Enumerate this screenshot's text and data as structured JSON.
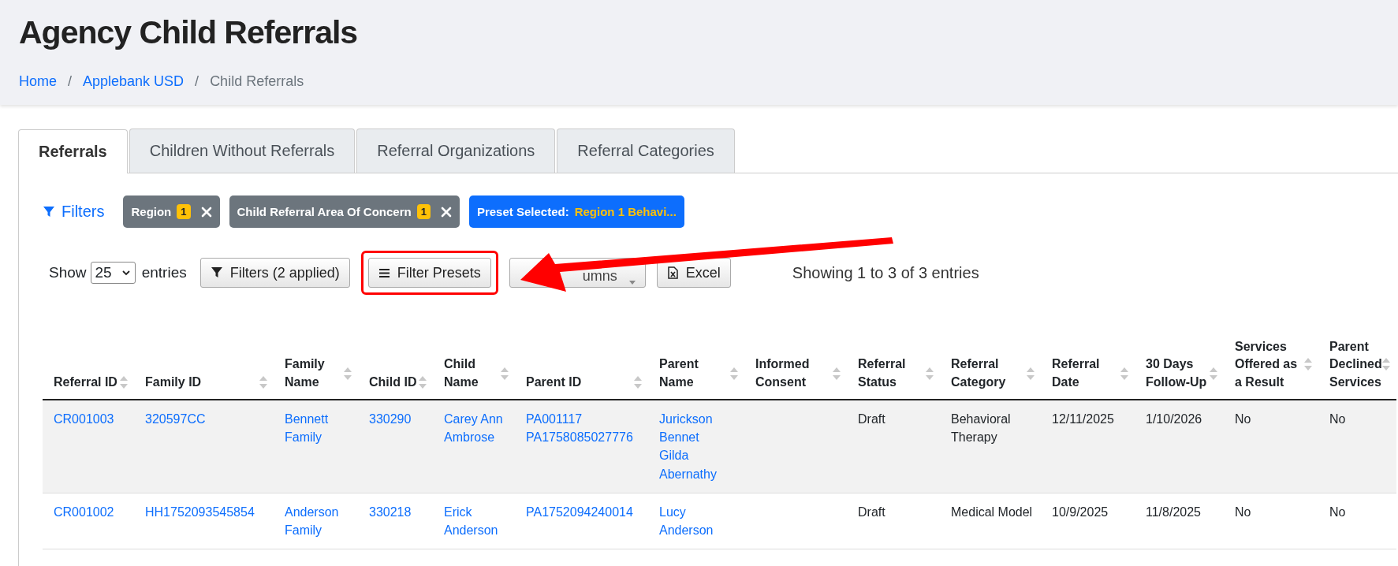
{
  "page_title": "Agency Child Referrals",
  "breadcrumb": [
    {
      "kind": "crumb",
      "label": "Home",
      "link": true
    },
    {
      "kind": "separator",
      "label": "/"
    },
    {
      "kind": "crumb",
      "label": "Applebank USD",
      "link": true
    },
    {
      "kind": "separator",
      "label": "/"
    },
    {
      "kind": "crumb",
      "label": "Child Referrals",
      "link": false
    }
  ],
  "tabs": [
    {
      "label": "Referrals",
      "selected": true
    },
    {
      "label": "Children Without Referrals",
      "selected": false
    },
    {
      "label": "Referral Organizations",
      "selected": false
    },
    {
      "label": "Referral Categories",
      "selected": false
    }
  ],
  "filters_toggle": "Filters",
  "filter_chips": [
    {
      "kind": "filter",
      "label": "Region",
      "count": "1"
    },
    {
      "kind": "filter",
      "label": "Child Referral Area Of Concern",
      "count": "1"
    },
    {
      "kind": "preset",
      "label": "Preset Selected:",
      "value": "Region 1 Behavi..."
    }
  ],
  "toolbar": {
    "show_label": "Show",
    "page_size": "25",
    "entries_label": "entries",
    "buttons": [
      {
        "kind": "filter",
        "label": "Filters (2 applied)",
        "highlighted": false
      },
      {
        "kind": "menu",
        "label": "Filter Presets",
        "highlighted": true
      },
      {
        "kind": "dropdown",
        "label": "umns",
        "highlighted": false
      },
      {
        "kind": "excel",
        "label": "Excel",
        "highlighted": false
      }
    ],
    "info": "Showing 1 to 3 of 3 entries"
  },
  "table": {
    "columns": [
      "Referral ID",
      "Family ID",
      "Family Name",
      "Child ID",
      "Child Name",
      "Parent ID",
      "Parent Name",
      "Informed Consent",
      "Referral Status",
      "Referral Category",
      "Referral Date",
      "30 Days Follow-Up",
      "Services Offered as a Result",
      "Parent Declined Services"
    ],
    "rows": [
      {
        "cells": [
          {
            "kind": "link",
            "values": [
              "CR001003"
            ]
          },
          {
            "kind": "link",
            "values": [
              "320597CC"
            ]
          },
          {
            "kind": "link",
            "values": [
              "Bennett Family"
            ]
          },
          {
            "kind": "link",
            "values": [
              "330290"
            ]
          },
          {
            "kind": "link",
            "values": [
              "Carey Ann Ambrose"
            ]
          },
          {
            "kind": "link",
            "values": [
              "PA001117",
              "PA1758085027776"
            ]
          },
          {
            "kind": "link",
            "values": [
              "Jurickson Bennet",
              "Gilda Abernathy"
            ]
          },
          {
            "kind": "empty"
          },
          {
            "kind": "text",
            "values": [
              "Draft"
            ]
          },
          {
            "kind": "text",
            "values": [
              "Behavioral Therapy"
            ]
          },
          {
            "kind": "text",
            "values": [
              "12/11/2025"
            ]
          },
          {
            "kind": "text",
            "values": [
              "1/10/2026"
            ]
          },
          {
            "kind": "text",
            "values": [
              "No"
            ]
          },
          {
            "kind": "text",
            "values": [
              "No"
            ]
          }
        ]
      },
      {
        "cells": [
          {
            "kind": "link",
            "values": [
              "CR001002"
            ]
          },
          {
            "kind": "link",
            "values": [
              "HH1752093545854"
            ]
          },
          {
            "kind": "link",
            "values": [
              "Anderson Family"
            ]
          },
          {
            "kind": "link",
            "values": [
              "330218"
            ]
          },
          {
            "kind": "link",
            "values": [
              "Erick Anderson"
            ]
          },
          {
            "kind": "link",
            "values": [
              "PA1752094240014"
            ]
          },
          {
            "kind": "link",
            "values": [
              "Lucy Anderson"
            ]
          },
          {
            "kind": "empty"
          },
          {
            "kind": "text",
            "values": [
              "Draft"
            ]
          },
          {
            "kind": "text",
            "values": [
              "Medical Model"
            ]
          },
          {
            "kind": "text",
            "values": [
              "10/9/2025"
            ]
          },
          {
            "kind": "text",
            "values": [
              "11/8/2025"
            ]
          },
          {
            "kind": "text",
            "values": [
              "No"
            ]
          },
          {
            "kind": "text",
            "values": [
              "No"
            ]
          }
        ]
      }
    ]
  }
}
